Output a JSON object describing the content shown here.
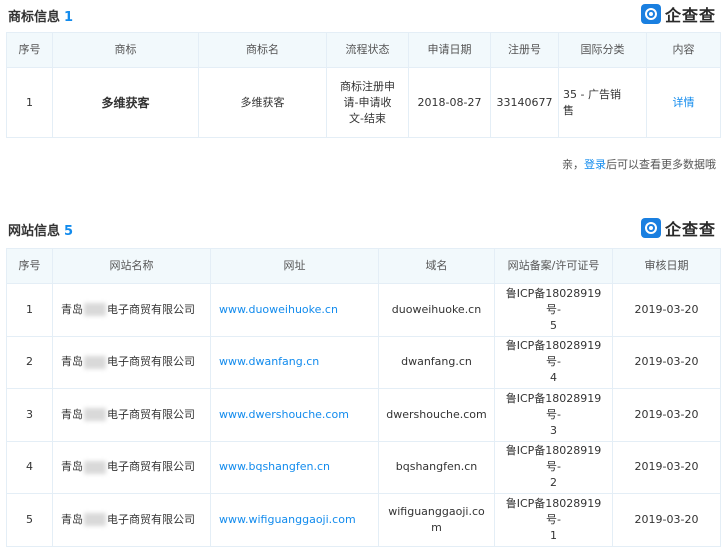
{
  "trademark": {
    "title": "商标信息",
    "count": "1",
    "brand": "企查查",
    "headers": [
      "序号",
      "商标",
      "商标名",
      "流程状态",
      "申请日期",
      "注册号",
      "国际分类",
      "内容"
    ],
    "rows": [
      {
        "no": "1",
        "mark": "多维获客",
        "name": "多维获客",
        "status": [
          "商标注册申",
          "请-申请收",
          "文-结束"
        ],
        "date": "2018-08-27",
        "reg_no": "33140677",
        "intl_class": [
          "35 - 广告销",
          "售"
        ],
        "detail": "详情"
      }
    ],
    "login_note_prefix": "亲，",
    "login_link": "登录",
    "login_note_suffix": "后可以查看更多数据哦"
  },
  "website": {
    "title": "网站信息",
    "count": "5",
    "brand": "企查查",
    "headers": [
      "序号",
      "网站名称",
      "网址",
      "域名",
      "网站备案/许可证号",
      "审核日期"
    ],
    "company_prefix": "青岛",
    "company_suffix": "电子商贸有限公司",
    "rows": [
      {
        "no": "1",
        "url": "www.duoweihuoke.cn",
        "domain": [
          "duoweihuoke.cn"
        ],
        "icp": [
          "鲁ICP备18028919号-",
          "5"
        ],
        "date": "2019-03-20"
      },
      {
        "no": "2",
        "url": "www.dwanfang.cn",
        "domain": [
          "dwanfang.cn"
        ],
        "icp": [
          "鲁ICP备18028919号-",
          "4"
        ],
        "date": "2019-03-20"
      },
      {
        "no": "3",
        "url": "www.dwershouche.com",
        "domain": [
          "dwershouche.com"
        ],
        "icp": [
          "鲁ICP备18028919号-",
          "3"
        ],
        "date": "2019-03-20"
      },
      {
        "no": "4",
        "url": "www.bqshangfen.cn",
        "domain": [
          "bqshangfen.cn"
        ],
        "icp": [
          "鲁ICP备18028919号-",
          "2"
        ],
        "date": "2019-03-20"
      },
      {
        "no": "5",
        "url": "www.wifiguanggaoji.com",
        "domain": [
          "wifiguanggaoji.co",
          "m"
        ],
        "icp": [
          "鲁ICP备18028919号-",
          "1"
        ],
        "date": "2019-03-20"
      }
    ]
  },
  "colors": {
    "accent": "#128bed",
    "header_bg": "#f2f9fc",
    "border": "#e4eef6",
    "brand": "#1a7fe0"
  }
}
